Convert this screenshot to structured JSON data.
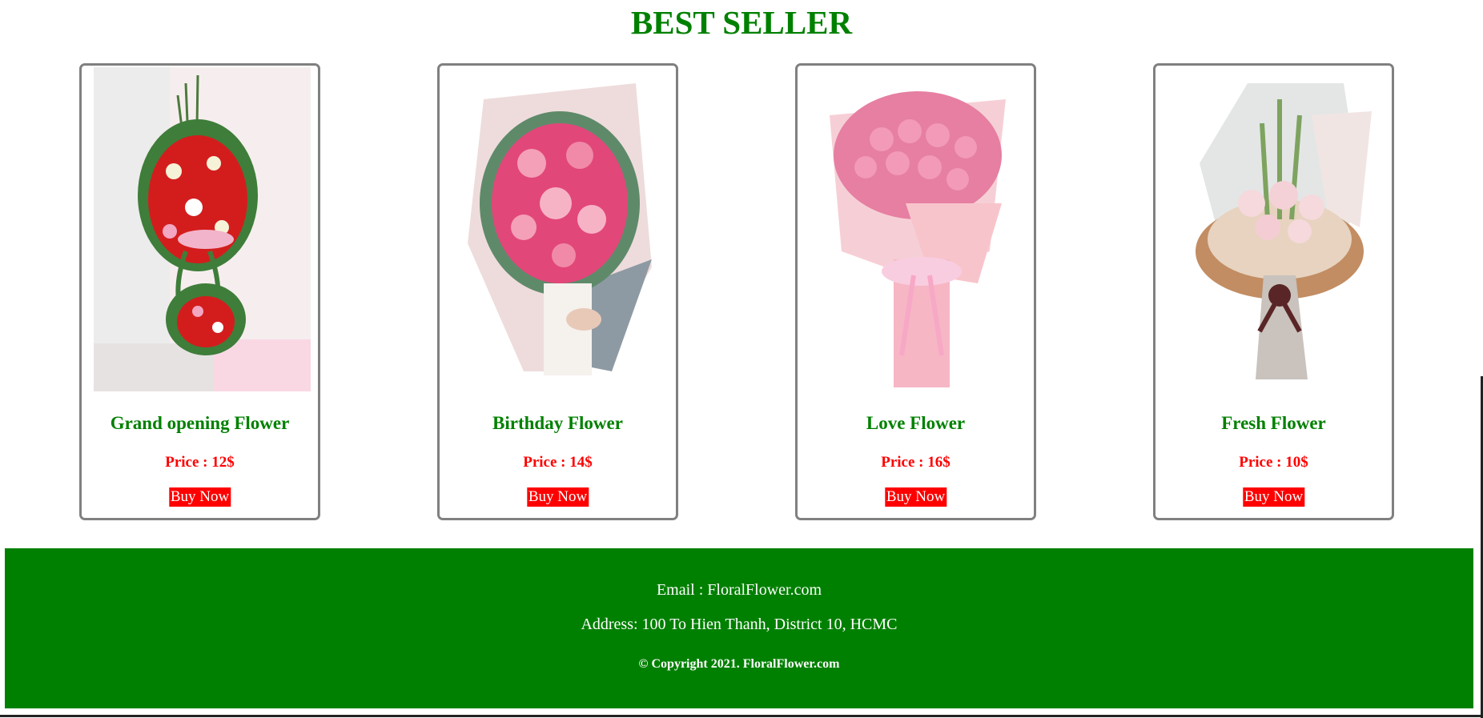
{
  "section": {
    "title": "BEST SELLER"
  },
  "products": [
    {
      "name": "Grand opening Flower",
      "price": "Price : 12$",
      "button": "Buy Now",
      "image_icon": "grand-opening-flower-stand-image"
    },
    {
      "name": "Birthday Flower",
      "price": "Price : 14$",
      "button": "Buy Now",
      "image_icon": "birthday-bouquet-image"
    },
    {
      "name": "Love Flower",
      "price": "Price : 16$",
      "button": "Buy Now",
      "image_icon": "pink-rose-bouquet-image"
    },
    {
      "name": "Fresh Flower",
      "price": "Price : 10$",
      "button": "Buy Now",
      "image_icon": "fresh-flower-bouquet-image"
    }
  ],
  "footer": {
    "email": "Email : FloralFlower.com",
    "address": "Address: 100 To Hien Thanh, District 10, HCMC",
    "copyright": "© Copyright 2021. FloralFlower.com"
  },
  "colors": {
    "brand_green": "#008000",
    "price_red": "#ff0000",
    "button_red": "#ff0000",
    "card_border": "#808080"
  }
}
